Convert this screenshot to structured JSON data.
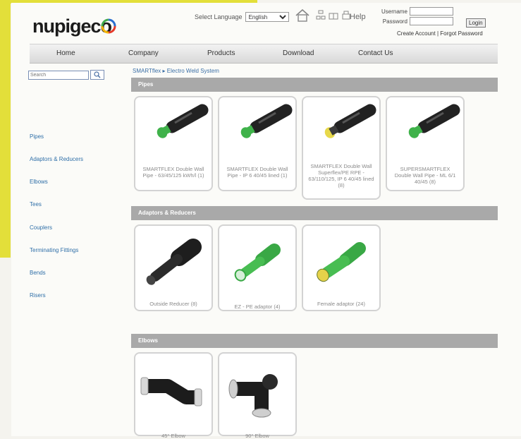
{
  "brand": {
    "name": "nupigeco"
  },
  "header": {
    "language_label": "Select Language",
    "language_value": "Englísh",
    "help": "Help",
    "username_label": "Username",
    "password_label": "Password",
    "login_button": "Login",
    "create_account": "Create Account",
    "separator": "|",
    "forgot_password": "Forgot Password"
  },
  "nav": [
    "Home",
    "Company",
    "Products",
    "Download",
    "Contact Us"
  ],
  "search": {
    "placeholder": "Search"
  },
  "sidebar": [
    "Pipes",
    "Adaptors & Reducers",
    "Elbows",
    "Tees",
    "Couplers",
    "Terminating Fittings",
    "Bends",
    "Risers"
  ],
  "breadcrumb": {
    "root": "SMARTflex",
    "separator": "▸",
    "current": "Electro Weld System"
  },
  "sections": [
    {
      "title": "Pipes",
      "items": [
        {
          "caption": "SMARTFLEX Double Wall Pipe - 63/45/125 kWh/l (1)"
        },
        {
          "caption": "SMARTFLEX Double Wall Pipe - IP 6 40/45 lined (1)"
        },
        {
          "caption": "SMARTFLEX Double Wall Superflex/PE RPE - 63/110/125, IP 6 40/45 lined (8)"
        },
        {
          "caption": "SUPERSMARTFLEX Double Wall Pipe - ML 6/1 40/45 (8)"
        }
      ]
    },
    {
      "title": "Adaptors & Reducers",
      "items": [
        {
          "caption": "Outside Reducer (8)"
        },
        {
          "caption": "EZ - PE adaptor (4)"
        },
        {
          "caption": "Female adaptor (24)"
        }
      ]
    },
    {
      "title": "Elbows",
      "items": [
        {
          "caption": "45° Elbow"
        },
        {
          "caption": "90° Elbow"
        }
      ]
    }
  ],
  "colors": {
    "link": "#2f6fa8",
    "section_bar": "#a9a9a9",
    "accent_yellow": "#e3df3a",
    "pipe_green": "#3fb24a"
  }
}
